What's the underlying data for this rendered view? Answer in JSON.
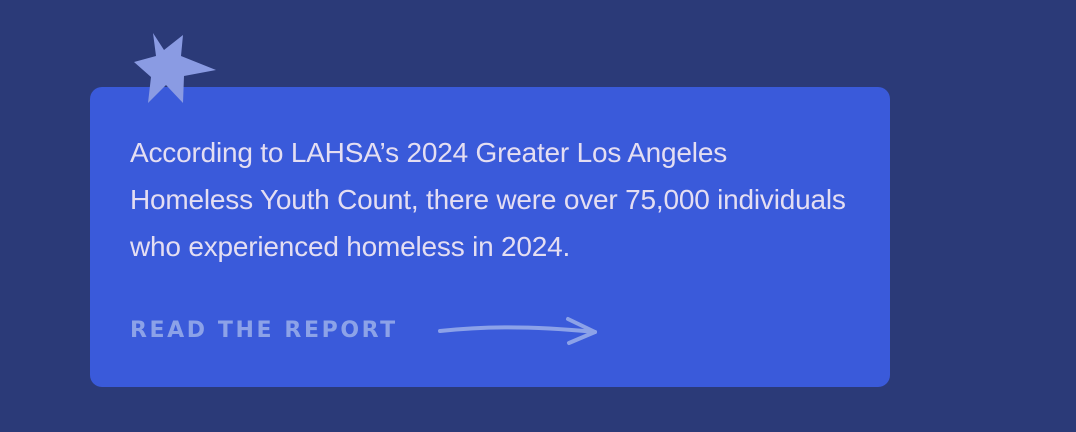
{
  "callout": {
    "body": "According to LAHSA’s 2024 Greater Los Angeles Homeless Youth Count, there were over 75,000 individuals who experienced homeless in 2024.",
    "cta_label": "READ THE REPORT"
  },
  "icons": {
    "decoration": "star-icon",
    "cta": "arrow-right-icon"
  },
  "colors": {
    "background": "#2b3a78",
    "card": "#3a5ada",
    "star": "#8a9be3",
    "body_text": "#e4def2",
    "accent": "#8ca2e8"
  }
}
